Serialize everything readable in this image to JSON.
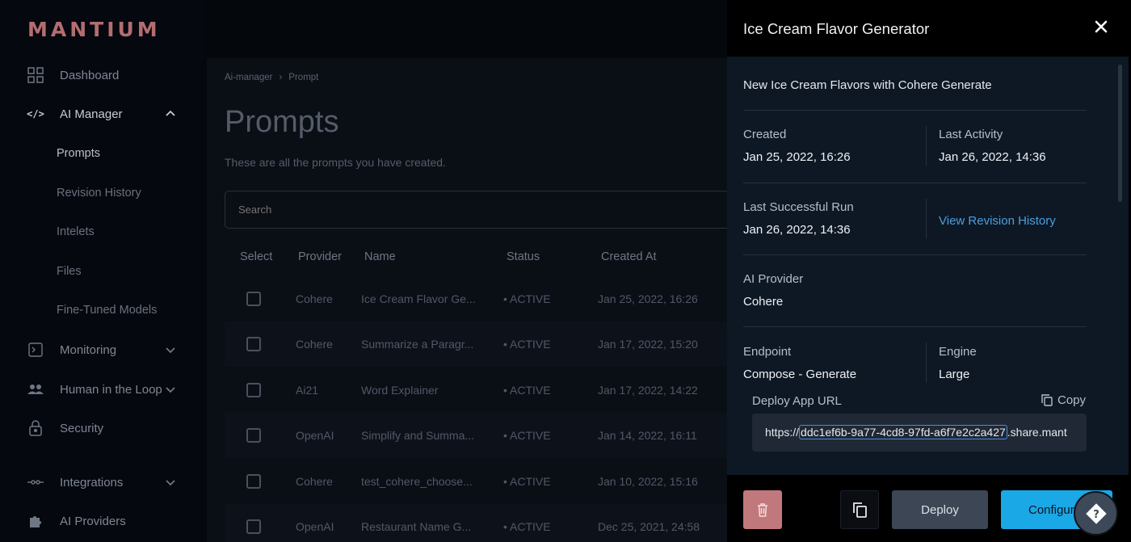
{
  "brand": {
    "logo": "MANTIUM",
    "accent": "#ee8f93",
    "link_color": "#4a9fe0",
    "primary_button": "#1ba8e6",
    "danger_button": "#c1787c"
  },
  "sidebar": {
    "items": [
      {
        "label": "Dashboard",
        "icon": "grid-icon"
      },
      {
        "label": "AI Manager",
        "icon": "code-icon",
        "expanded": true
      },
      {
        "label": "Monitoring",
        "icon": "terminal-icon"
      },
      {
        "label": "Human in the Loop",
        "icon": "people-icon"
      },
      {
        "label": "Security",
        "icon": "lock-icon"
      },
      {
        "label": "Integrations",
        "icon": "plug-icon"
      },
      {
        "label": "AI Providers",
        "icon": "puzzle-icon"
      }
    ],
    "ai_manager_subitems": [
      "Prompts",
      "Revision History",
      "Intelets",
      "Files",
      "Fine-Tuned Models"
    ],
    "current_subitem": "Prompts"
  },
  "main": {
    "breadcrumb": [
      "Ai-manager",
      "Prompt"
    ],
    "breadcrumb_sep": "›",
    "title": "Prompts",
    "subtitle": "These are all the prompts you have created.",
    "search_placeholder": "Search",
    "columns": [
      "Select",
      "Provider",
      "Name",
      "Status",
      "Created At"
    ],
    "rows": [
      {
        "provider": "Cohere",
        "name": "Ice Cream Flavor Ge...",
        "status": "• ACTIVE",
        "created": "Jan 25, 2022, 16:26"
      },
      {
        "provider": "Cohere",
        "name": "Summarize a Paragr...",
        "status": "• ACTIVE",
        "created": "Jan 17, 2022, 15:20"
      },
      {
        "provider": "Ai21",
        "name": "Word Explainer",
        "status": "• ACTIVE",
        "created": "Jan 17, 2022, 14:22"
      },
      {
        "provider": "OpenAI",
        "name": "Simplify and Summa...",
        "status": "• ACTIVE",
        "created": "Jan 14, 2022, 16:11"
      },
      {
        "provider": "Cohere",
        "name": "test_cohere_choose...",
        "status": "• ACTIVE",
        "created": "Jan 10, 2022, 15:16"
      },
      {
        "provider": "OpenAI",
        "name": "Restaurant Name G...",
        "status": "• ACTIVE",
        "created": "Dec 25, 2021, 24:58"
      }
    ]
  },
  "panel": {
    "title": "Ice Cream Flavor Generator",
    "description": "New Ice Cream Flavors with Cohere Generate",
    "created_label": "Created",
    "created_value": "Jan 25, 2022, 16:26",
    "last_activity_label": "Last Activity",
    "last_activity_value": "Jan 26, 2022, 14:36",
    "last_run_label": "Last Successful Run",
    "last_run_value": "Jan 26, 2022, 14:36",
    "revision_link": "View Revision History",
    "provider_label": "AI Provider",
    "provider_value": "Cohere",
    "endpoint_label": "Endpoint",
    "endpoint_value": "Compose - Generate",
    "engine_label": "Engine",
    "engine_value": "Large",
    "deploy_url_label": "Deploy App URL",
    "copy_label": "Copy",
    "url_prefix": "https://",
    "url_selected": "ddc1ef6b-9a77-4cd8-97fd-a6f7e2c2a427",
    "url_suffix": ".share.mant",
    "buttons": {
      "deploy": "Deploy",
      "configure": "Configure"
    }
  }
}
